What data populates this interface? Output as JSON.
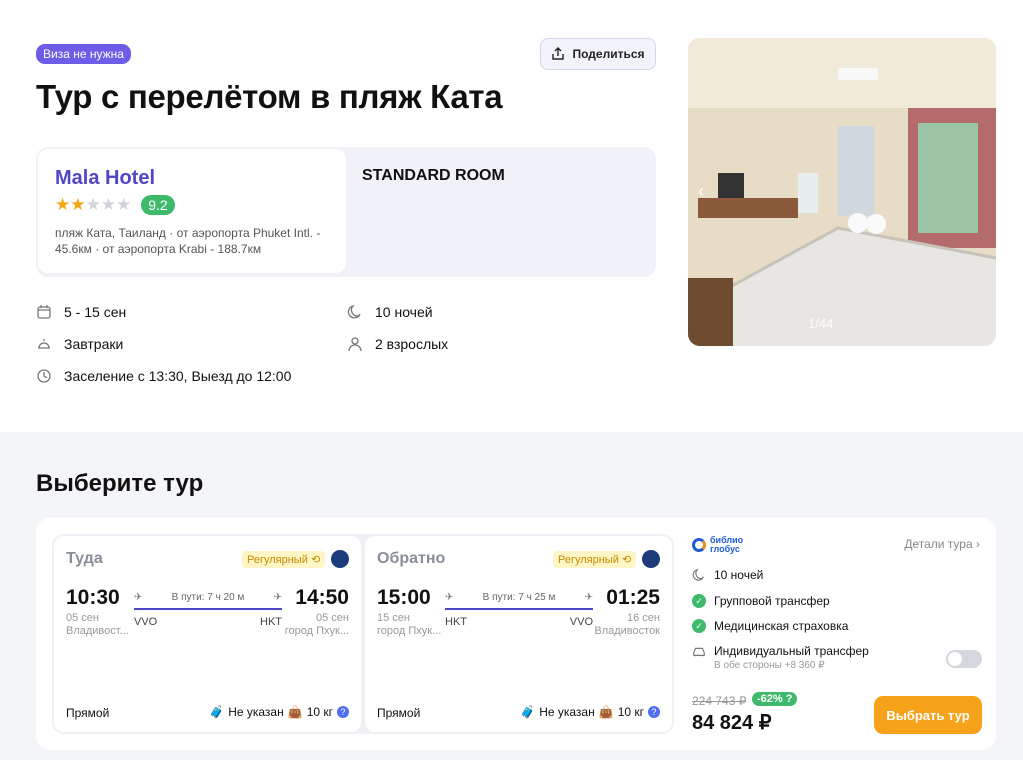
{
  "header": {
    "visa_badge": "Виза не нужна",
    "share_label": "Поделиться",
    "title": "Тур с перелётом в пляж Ката"
  },
  "hotel": {
    "name": "Mala Hotel",
    "stars": 2,
    "stars_max": 5,
    "score": "9.2",
    "location": "пляж Ката, Таиланд",
    "dist1": "от аэропорта Phuket Intl. - 45.6км",
    "dist2": "от аэропорта Krabi - 188.7км",
    "room": "STANDARD ROOM"
  },
  "facts": {
    "dates": "5 - 15 сен",
    "nights": "10 ночей",
    "meals": "Завтраки",
    "guests": "2 взрослых",
    "checkin": "Заселение с 13:30, Выезд до 12:00"
  },
  "gallery": {
    "counter": "1/44"
  },
  "choose": {
    "title": "Выберите тур"
  },
  "flights": [
    {
      "title": "Туда",
      "badge": "Регулярный",
      "dep_time": "10:30",
      "dep_date": "05 сен",
      "dep_city": "Владивост...",
      "dep_code": "VVO",
      "duration": "В пути: 7 ч 20 м",
      "arr_time": "14:50",
      "arr_date": "05 сен",
      "arr_city": "город Пхук...",
      "arr_code": "HKT",
      "type": "Прямой",
      "baggage": "Не указан",
      "hand_luggage": "10 кг"
    },
    {
      "title": "Обратно",
      "badge": "Регулярный",
      "dep_time": "15:00",
      "dep_date": "15 сен",
      "dep_city": "город Пхук...",
      "dep_code": "HKT",
      "duration": "В пути: 7 ч 25 м",
      "arr_time": "01:25",
      "arr_date": "16 сен",
      "arr_city": "Владивосток",
      "arr_code": "VVO",
      "type": "Прямой",
      "baggage": "Не указан",
      "hand_luggage": "10 кг"
    }
  ],
  "tour": {
    "operator_line1": "библио",
    "operator_line2": "глобус",
    "details_label": "Детали тура",
    "nights": "10 ночей",
    "transfer": "Групповой трансфер",
    "insurance": "Медицинская страховка",
    "ind_transfer": "Индивидуальный трансфер",
    "ind_transfer_note": "В обе стороны +8 360 ₽",
    "old_price": "224 743 ₽",
    "discount": "-62%",
    "price": "84 824 ₽",
    "select_label": "Выбрать тур"
  },
  "colors": {
    "accent": "#5046c8",
    "orange": "#f6a21b",
    "green": "#3fb96b"
  }
}
